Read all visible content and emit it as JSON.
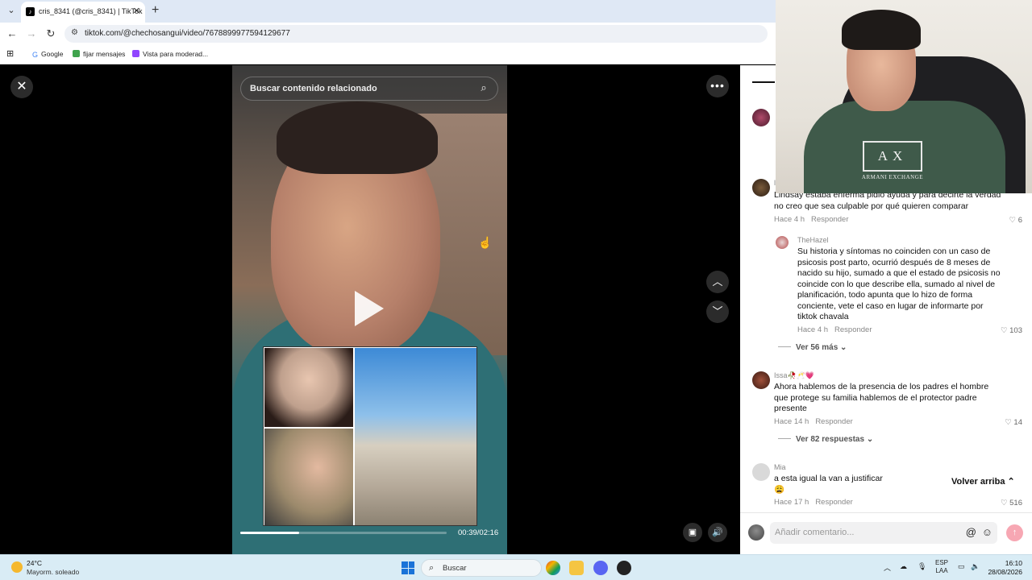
{
  "browser": {
    "tab_title": "cris_8341 (@cris_8341) | TikTok",
    "url": "tiktok.com/@chechosangui/video/7678899977594129677",
    "bookmarks": [
      "Google",
      "fijar mensajes",
      "Vista para moderad..."
    ]
  },
  "video": {
    "search_placeholder": "Buscar contenido relacionado",
    "time": "00:39/02:16",
    "progress_fraction": 0.287
  },
  "comments": {
    "items": [
      {
        "user": "l",
        "text": "Lindsay estaba enferma pidió ayuda y para decirte la verdad no creo que sea culpable por qué quieren comparar",
        "time": "Hace 4 h",
        "reply": "Responder",
        "likes": "6"
      },
      {
        "user": "TheHazel",
        "text": "Su historia y síntomas no coinciden con un caso de psicosis post parto, ocurrió después de 8 meses de nacido su hijo, sumado a que el estado de psicosis no coincide con lo que describe ella, sumado al nivel de planificación, todo apunta que lo hizo de forma conciente, vete el caso en lugar de informarte por tiktok chavala",
        "time": "Hace 4 h",
        "reply": "Responder",
        "likes": "103"
      },
      {
        "user": "Issa🥀🥂💗",
        "text": "Ahora hablemos de la presencia de los padres el hombre que protege su familia hablemos de el protector padre presente",
        "time": "Hace 14 h",
        "reply": "Responder",
        "likes": "14"
      },
      {
        "user": "Mia",
        "text": "a esta igual la van a justificar 😩",
        "time": "Hace 17 h",
        "reply": "Responder",
        "likes": "516"
      }
    ],
    "more_1": "Ver 56 más",
    "more_2": "Ver 82 respuestas",
    "back_to_top": "Volver arriba",
    "add_placeholder": "Añadir comentario..."
  },
  "webcam": {
    "logo_text": "AX",
    "logo_sub": "ARMANI EXCHANGE"
  },
  "taskbar": {
    "temp": "24°C",
    "weather": "Mayorm. soleado",
    "search": "Buscar",
    "lang1": "ESP",
    "lang2": "LAA",
    "time": "16:10",
    "date": "28/08/2026"
  },
  "colors": {
    "send_button": "#f7a7b3",
    "taskbar_bg": "#d9ecf5",
    "tab_bar_bg": "#dfe8f5"
  }
}
